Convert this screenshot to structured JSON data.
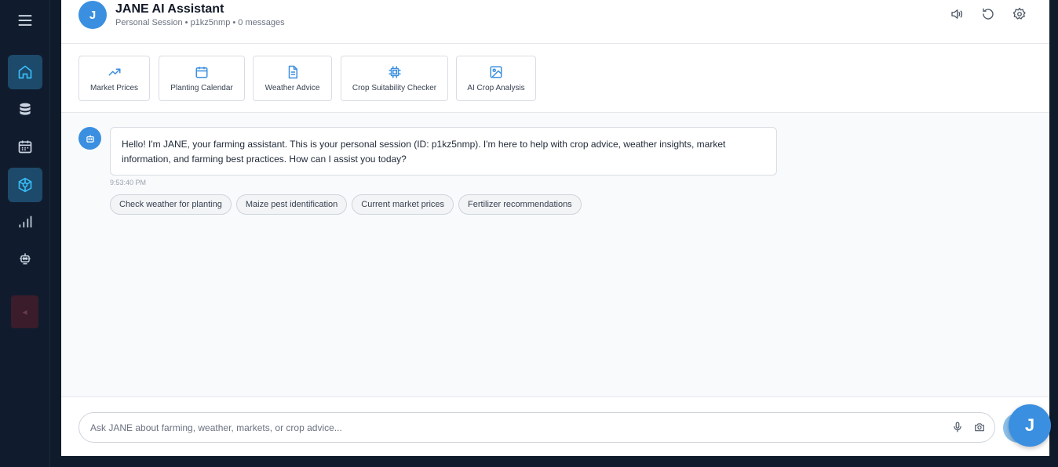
{
  "header": {
    "avatar_letter": "J",
    "title": "JANE AI Assistant",
    "subtitle": "Personal Session • p1kz5nmp • 0 messages"
  },
  "sidebar": {
    "items": [
      {
        "icon": "home-icon",
        "active": true
      },
      {
        "icon": "database-icon",
        "active": false
      },
      {
        "icon": "calendar-icon",
        "active": false
      },
      {
        "icon": "cube-network-icon",
        "active": true
      },
      {
        "icon": "bar-chart-icon",
        "active": false
      },
      {
        "icon": "robot-icon",
        "active": false
      }
    ]
  },
  "quick_actions": [
    {
      "label": "Market Prices",
      "icon": "trending-up-icon"
    },
    {
      "label": "Planting Calendar",
      "icon": "calendar-icon"
    },
    {
      "label": "Weather Advice",
      "icon": "document-icon"
    },
    {
      "label": "Crop Suitability Checker",
      "icon": "chip-icon"
    },
    {
      "label": "AI Crop Analysis",
      "icon": "image-icon"
    }
  ],
  "chat": {
    "messages": [
      {
        "text": "Hello! I'm JANE, your farming assistant. This is your personal session (ID: p1kz5nmp). I'm here to help with crop advice, weather insights, market information, and farming best practices. How can I assist you today?",
        "time": "9:53:40 PM"
      }
    ],
    "suggestions": [
      "Check weather for planting",
      "Maize pest identification",
      "Current market prices",
      "Fertilizer recommendations"
    ]
  },
  "input": {
    "placeholder": "Ask JANE about farming, weather, markets, or crop advice...",
    "value": ""
  },
  "fab": {
    "letter": "J"
  },
  "colors": {
    "accent": "#3b8fe0",
    "sidebar_bg": "#101c2d",
    "sidebar_active": "#1d4a6a",
    "icon_active": "#38bdf8"
  }
}
